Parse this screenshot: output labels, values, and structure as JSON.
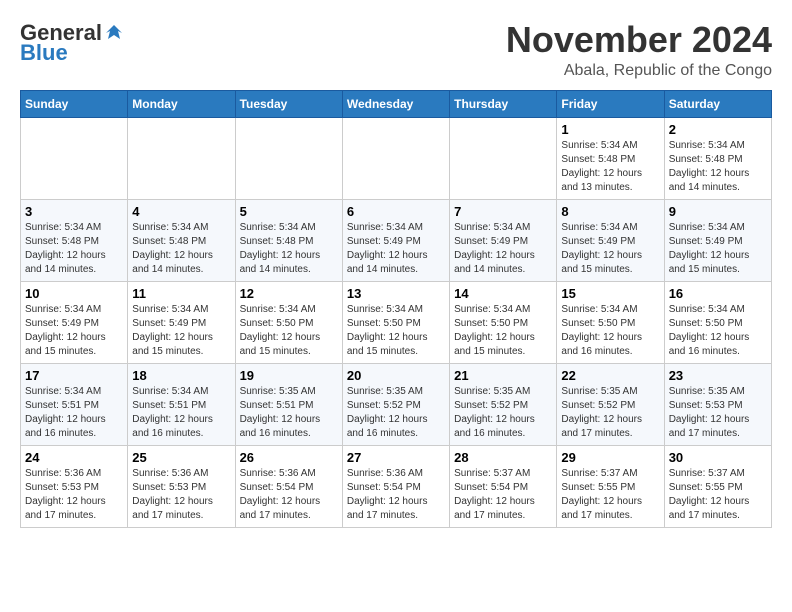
{
  "logo": {
    "general": "General",
    "blue": "Blue"
  },
  "title": "November 2024",
  "location": "Abala, Republic of the Congo",
  "days_of_week": [
    "Sunday",
    "Monday",
    "Tuesday",
    "Wednesday",
    "Thursday",
    "Friday",
    "Saturday"
  ],
  "weeks": [
    [
      {
        "day": "",
        "info": ""
      },
      {
        "day": "",
        "info": ""
      },
      {
        "day": "",
        "info": ""
      },
      {
        "day": "",
        "info": ""
      },
      {
        "day": "",
        "info": ""
      },
      {
        "day": "1",
        "info": "Sunrise: 5:34 AM\nSunset: 5:48 PM\nDaylight: 12 hours\nand 13 minutes."
      },
      {
        "day": "2",
        "info": "Sunrise: 5:34 AM\nSunset: 5:48 PM\nDaylight: 12 hours\nand 14 minutes."
      }
    ],
    [
      {
        "day": "3",
        "info": "Sunrise: 5:34 AM\nSunset: 5:48 PM\nDaylight: 12 hours\nand 14 minutes."
      },
      {
        "day": "4",
        "info": "Sunrise: 5:34 AM\nSunset: 5:48 PM\nDaylight: 12 hours\nand 14 minutes."
      },
      {
        "day": "5",
        "info": "Sunrise: 5:34 AM\nSunset: 5:48 PM\nDaylight: 12 hours\nand 14 minutes."
      },
      {
        "day": "6",
        "info": "Sunrise: 5:34 AM\nSunset: 5:49 PM\nDaylight: 12 hours\nand 14 minutes."
      },
      {
        "day": "7",
        "info": "Sunrise: 5:34 AM\nSunset: 5:49 PM\nDaylight: 12 hours\nand 14 minutes."
      },
      {
        "day": "8",
        "info": "Sunrise: 5:34 AM\nSunset: 5:49 PM\nDaylight: 12 hours\nand 15 minutes."
      },
      {
        "day": "9",
        "info": "Sunrise: 5:34 AM\nSunset: 5:49 PM\nDaylight: 12 hours\nand 15 minutes."
      }
    ],
    [
      {
        "day": "10",
        "info": "Sunrise: 5:34 AM\nSunset: 5:49 PM\nDaylight: 12 hours\nand 15 minutes."
      },
      {
        "day": "11",
        "info": "Sunrise: 5:34 AM\nSunset: 5:49 PM\nDaylight: 12 hours\nand 15 minutes."
      },
      {
        "day": "12",
        "info": "Sunrise: 5:34 AM\nSunset: 5:50 PM\nDaylight: 12 hours\nand 15 minutes."
      },
      {
        "day": "13",
        "info": "Sunrise: 5:34 AM\nSunset: 5:50 PM\nDaylight: 12 hours\nand 15 minutes."
      },
      {
        "day": "14",
        "info": "Sunrise: 5:34 AM\nSunset: 5:50 PM\nDaylight: 12 hours\nand 15 minutes."
      },
      {
        "day": "15",
        "info": "Sunrise: 5:34 AM\nSunset: 5:50 PM\nDaylight: 12 hours\nand 16 minutes."
      },
      {
        "day": "16",
        "info": "Sunrise: 5:34 AM\nSunset: 5:50 PM\nDaylight: 12 hours\nand 16 minutes."
      }
    ],
    [
      {
        "day": "17",
        "info": "Sunrise: 5:34 AM\nSunset: 5:51 PM\nDaylight: 12 hours\nand 16 minutes."
      },
      {
        "day": "18",
        "info": "Sunrise: 5:34 AM\nSunset: 5:51 PM\nDaylight: 12 hours\nand 16 minutes."
      },
      {
        "day": "19",
        "info": "Sunrise: 5:35 AM\nSunset: 5:51 PM\nDaylight: 12 hours\nand 16 minutes."
      },
      {
        "day": "20",
        "info": "Sunrise: 5:35 AM\nSunset: 5:52 PM\nDaylight: 12 hours\nand 16 minutes."
      },
      {
        "day": "21",
        "info": "Sunrise: 5:35 AM\nSunset: 5:52 PM\nDaylight: 12 hours\nand 16 minutes."
      },
      {
        "day": "22",
        "info": "Sunrise: 5:35 AM\nSunset: 5:52 PM\nDaylight: 12 hours\nand 17 minutes."
      },
      {
        "day": "23",
        "info": "Sunrise: 5:35 AM\nSunset: 5:53 PM\nDaylight: 12 hours\nand 17 minutes."
      }
    ],
    [
      {
        "day": "24",
        "info": "Sunrise: 5:36 AM\nSunset: 5:53 PM\nDaylight: 12 hours\nand 17 minutes."
      },
      {
        "day": "25",
        "info": "Sunrise: 5:36 AM\nSunset: 5:53 PM\nDaylight: 12 hours\nand 17 minutes."
      },
      {
        "day": "26",
        "info": "Sunrise: 5:36 AM\nSunset: 5:54 PM\nDaylight: 12 hours\nand 17 minutes."
      },
      {
        "day": "27",
        "info": "Sunrise: 5:36 AM\nSunset: 5:54 PM\nDaylight: 12 hours\nand 17 minutes."
      },
      {
        "day": "28",
        "info": "Sunrise: 5:37 AM\nSunset: 5:54 PM\nDaylight: 12 hours\nand 17 minutes."
      },
      {
        "day": "29",
        "info": "Sunrise: 5:37 AM\nSunset: 5:55 PM\nDaylight: 12 hours\nand 17 minutes."
      },
      {
        "day": "30",
        "info": "Sunrise: 5:37 AM\nSunset: 5:55 PM\nDaylight: 12 hours\nand 17 minutes."
      }
    ]
  ]
}
